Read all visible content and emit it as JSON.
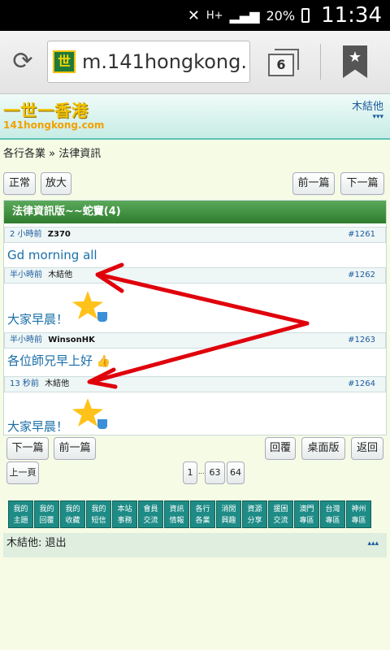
{
  "status": {
    "network": "H+",
    "battery": "20%",
    "time": "11:34"
  },
  "browser": {
    "url": "m.141hongkong.",
    "tab_count": "6",
    "favicon_char": "世"
  },
  "site": {
    "logo_main": "一世一香港",
    "logo_sub": "141hongkong.com",
    "username": "木結他",
    "user_menu": "▾▾▾"
  },
  "breadcrumb": {
    "part1": "各行各業",
    "sep": "»",
    "part2": "法律資訊"
  },
  "top_buttons": {
    "normal": "正常",
    "zoom": "放大",
    "prev": "前一篇",
    "next": "下一篇"
  },
  "thread": {
    "title": "法律資訊版~~蛇竇(4)",
    "posts": [
      {
        "time": "2 小時前",
        "author": "Z370",
        "num": "#1261",
        "body": "Gd morning all"
      },
      {
        "time": "半小時前",
        "author": "木結他",
        "num": "#1262",
        "body": "大家早晨！"
      },
      {
        "time": "半小時前",
        "author": "WinsonHK",
        "num": "#1263",
        "body": "各位師兄早上好"
      },
      {
        "time": "13 秒前",
        "author": "木結他",
        "num": "#1264",
        "body": "大家早晨！"
      }
    ]
  },
  "bottom_buttons": {
    "next": "下一篇",
    "prev": "前一篇",
    "reply": "回覆",
    "desktop": "桌面版",
    "back": "返回"
  },
  "pager": {
    "prev_page": "上一頁",
    "first": "1",
    "dots": "...",
    "p63": "63",
    "p64": "64"
  },
  "nav": [
    {
      "l1": "我的",
      "l2": "主題"
    },
    {
      "l1": "我的",
      "l2": "回覆"
    },
    {
      "l1": "我的",
      "l2": "收藏"
    },
    {
      "l1": "我的",
      "l2": "短信"
    },
    {
      "l1": "本站",
      "l2": "事務"
    },
    {
      "l1": "會員",
      "l2": "交流"
    },
    {
      "l1": "資訊",
      "l2": "情報"
    },
    {
      "l1": "各行",
      "l2": "各業"
    },
    {
      "l1": "消閒",
      "l2": "興趣"
    },
    {
      "l1": "資源",
      "l2": "分享"
    },
    {
      "l1": "援困",
      "l2": "交流"
    },
    {
      "l1": "澳門",
      "l2": "專區"
    },
    {
      "l1": "台灣",
      "l2": "專區"
    },
    {
      "l1": "神州",
      "l2": "專區"
    }
  ],
  "footer": {
    "logout": "木結他: 退出",
    "arrows": "▴▴▴"
  }
}
